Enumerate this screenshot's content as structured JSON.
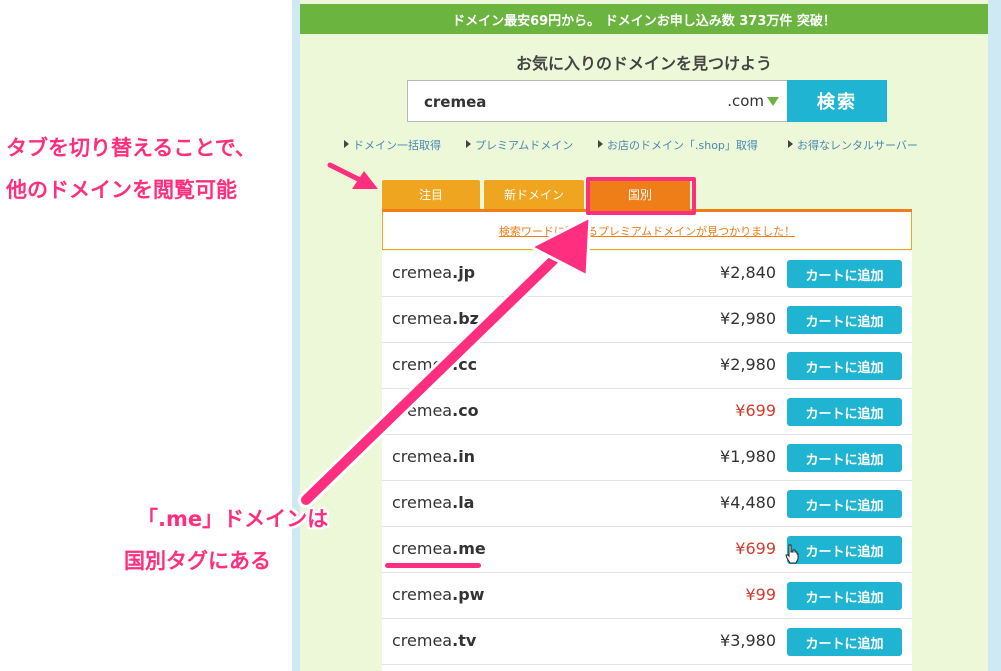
{
  "topbar": {
    "text": "ドメイン最安69円から。 ドメインお申し込み数  373万件 突破！"
  },
  "headline": "お気に入りのドメインを見つけよう",
  "search": {
    "value": "cremea",
    "tld": ".com",
    "button_label": "検索"
  },
  "links": [
    "ドメイン一括取得",
    "プレミアムドメイン",
    "お店のドメイン「.shop」取得",
    "お得なレンタルサーバー"
  ],
  "tabs": [
    {
      "label": "注目",
      "active": false
    },
    {
      "label": "新ドメイン",
      "active": false
    },
    {
      "label": "国別",
      "active": true
    }
  ],
  "notice": "検索ワードに関するプレミアムドメインが見つかりました！",
  "domains": [
    {
      "name": "cremea",
      "tld": ".jp",
      "price": "¥2,840",
      "sale": false,
      "button": "カートに追加"
    },
    {
      "name": "cremea",
      "tld": ".bz",
      "price": "¥2,980",
      "sale": false,
      "button": "カートに追加"
    },
    {
      "name": "cremea",
      "tld": ".cc",
      "price": "¥2,980",
      "sale": false,
      "button": "カートに追加"
    },
    {
      "name": "cremea",
      "tld": ".co",
      "price": "¥699",
      "sale": true,
      "button": "カートに追加"
    },
    {
      "name": "cremea",
      "tld": ".in",
      "price": "¥1,980",
      "sale": false,
      "button": "カートに追加"
    },
    {
      "name": "cremea",
      "tld": ".la",
      "price": "¥4,480",
      "sale": false,
      "button": "カートに追加"
    },
    {
      "name": "cremea",
      "tld": ".me",
      "price": "¥699",
      "sale": true,
      "button": "カートに追加"
    },
    {
      "name": "cremea",
      "tld": ".pw",
      "price": "¥99",
      "sale": true,
      "button": "カートに追加"
    },
    {
      "name": "cremea",
      "tld": ".tv",
      "price": "¥3,980",
      "sale": false,
      "button": "カートに追加"
    }
  ],
  "annotations": {
    "tabs_line1": "タブを切り替えることで、",
    "tabs_line2": "他のドメインを閲覧可能",
    "me_line1": "「.me」ドメインは",
    "me_line2": "国別タグにある"
  },
  "colors": {
    "topbar": "#6ab43f",
    "accent_blue": "#1fb4d2",
    "tab_orange": "#f0a521",
    "tab_active": "#ef7e19",
    "annotation_pink": "#ff2e7e",
    "sale_red": "#d33b2d"
  },
  "icons": {
    "tld_dropdown": "triangle-down-icon",
    "link_bullet": "triangle-right-icon",
    "cursor": "hand-pointer-icon",
    "annotation_arrow": "arrow-icon"
  }
}
